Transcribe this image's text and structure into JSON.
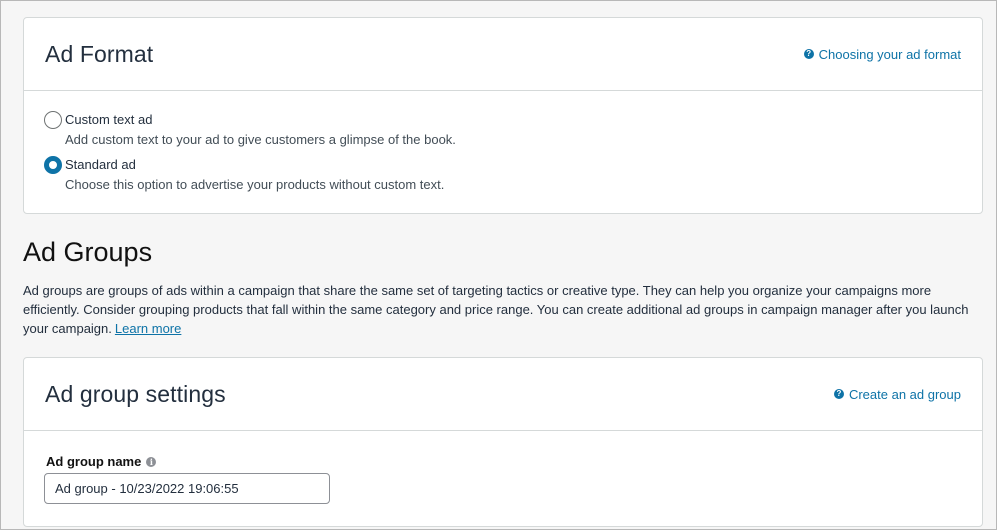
{
  "ad_format": {
    "title": "Ad Format",
    "help_link": "Choosing your ad format",
    "options": [
      {
        "label": "Custom text ad",
        "description": "Add custom text to your ad to give customers a glimpse of the book.",
        "selected": false
      },
      {
        "label": "Standard ad",
        "description": "Choose this option to advertise your products without custom text.",
        "selected": true
      }
    ]
  },
  "ad_groups": {
    "title": "Ad Groups",
    "description": "Ad groups are groups of ads within a campaign that share the same set of targeting tactics or creative type. They can help you organize your campaigns more efficiently. Consider grouping products that fall within the same category and price range. You can create additional ad groups in campaign manager after you launch your campaign.",
    "learn_more": "Learn more"
  },
  "ad_group_settings": {
    "title": "Ad group settings",
    "help_link": "Create an ad group",
    "name_label": "Ad group name",
    "name_value": "Ad group - 10/23/2022 19:06:55"
  },
  "icons": {
    "help": "question-circle-icon",
    "info": "info-circle-icon"
  },
  "colors": {
    "accent": "#0e73a7",
    "text": "#232f3e",
    "background": "#f6f6f6"
  }
}
